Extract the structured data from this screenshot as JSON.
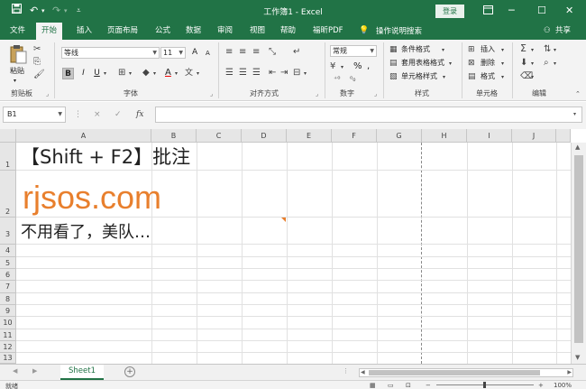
{
  "title_bar": {
    "save_icon": "save-icon",
    "undo_icon": "undo-icon",
    "redo_icon": "redo-icon",
    "customize_icon": "customize-qat-icon",
    "doc_title": "工作簿1 - Excel",
    "login_label": "登录",
    "ribbon_display_icon": "ribbon-display-icon",
    "minimize_icon": "minimize-icon",
    "maximize_icon": "maximize-icon",
    "close_icon": "close-icon",
    "bg_color": "#217346"
  },
  "tabs": [
    {
      "label": "文件"
    },
    {
      "label": "开始"
    },
    {
      "label": "插入"
    },
    {
      "label": "页面布局"
    },
    {
      "label": "公式"
    },
    {
      "label": "数据"
    },
    {
      "label": "审阅"
    },
    {
      "label": "视图"
    },
    {
      "label": "帮助"
    },
    {
      "label": "福昕PDF"
    }
  ],
  "tell_me": {
    "icon": "lightbulb-icon",
    "label": "操作说明搜索"
  },
  "share": {
    "icon": "person-icon",
    "label": "共享"
  },
  "ribbon": {
    "clipboard": {
      "paste_label": "粘贴",
      "group_label": "剪贴板"
    },
    "font": {
      "font_name": "等线",
      "font_size": "11",
      "bold": "B",
      "italic": "I",
      "underline": "U",
      "grow_font": "A",
      "shrink_font": "A",
      "font_color": "A",
      "group_label": "字体"
    },
    "alignment": {
      "group_label": "对齐方式"
    },
    "number": {
      "format": "常规",
      "percent": "%",
      "comma": ",",
      "group_label": "数字"
    },
    "styles": {
      "conditional": "条件格式",
      "table": "套用表格格式",
      "cell_styles": "单元格样式",
      "group_label": "样式"
    },
    "cells": {
      "insert": "插入",
      "delete": "删除",
      "format": "格式",
      "group_label": "单元格"
    },
    "editing": {
      "group_label": "编辑"
    }
  },
  "formula_bar": {
    "name_box": "B1",
    "cancel_icon": "×",
    "enter_icon": "✓",
    "fx_label": "fx",
    "formula": ""
  },
  "sheet": {
    "columns": [
      "A",
      "B",
      "C",
      "D",
      "E",
      "F",
      "G",
      "H",
      "I",
      "J"
    ],
    "rows": [
      "1",
      "2",
      "3",
      "4",
      "5",
      "6",
      "7",
      "8",
      "9",
      "10",
      "11",
      "12",
      "13"
    ],
    "a1": "【Shift + F2】批注",
    "a2": "rjsos.com",
    "a2_color": "#e87f2d",
    "a3": "不用看了，美队…",
    "comment_indicator_color": "#e87f2d"
  },
  "sheet_tabs": {
    "active": "Sheet1",
    "add_icon": "add-sheet-icon"
  },
  "status": {
    "ready": "就绪",
    "zoom": "100%"
  }
}
